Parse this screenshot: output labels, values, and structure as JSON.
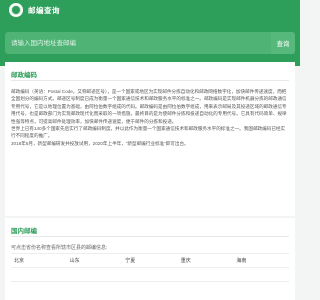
{
  "header": {
    "title": "邮编查询"
  },
  "search": {
    "placeholder": "请输入国内地址查邮编",
    "button_label": "查询"
  },
  "intro_card": {
    "title": "邮政编码",
    "paragraphs": [
      "邮政编码（英语：Postal Code，又称邮递区号），是一个国家或地区为实现邮件分拣自动化和邮政网络数字化，加快邮件传递速度，而把全国划分的编码方式。邮递区号制度已成为衡量一个国家通信技术和邮政服务水平的标准之一。邮政编码是实现邮件机器分拣的邮政通信专用代号，它是以地理位置为基础，由阿拉伯数字组成的代码。邮政编码是由阿拉伯数字组成，用来表示邮局及其投递区域的邮政通信专用代号，也是邮政部门为实现邮政现代化而采取的一项措施，最终目的是为使邮件分拣和投递自动化的专用代号。它具有代码简单、规律性强等特点，可提高邮件处理效率，加快邮件传递速度，便于邮件的分拣和投递。",
      "世界上已有140多个国家先后实行了邮政编码制度，并以此作为衡量一个国家通信技术和邮政服务水平的标准之一。我国邮政编码已经实行不同程度的推广。",
      "2018年5月，新型邮编研发并投放试用，2020年上半年，“新型邮编行业标准”即可出台。"
    ]
  },
  "province_card": {
    "title": "国内邮编",
    "note": "可点击省份名称查看所辖市区县的邮编信息:",
    "rows": [
      [
        "北京",
        "山东",
        "宁夏",
        "重庆",
        "海南"
      ],
      [
        "",
        "",
        "",
        "",
        ""
      ]
    ]
  },
  "colors": {
    "brand_green": "#2e9e5b",
    "title_green": "#2e9e5b",
    "background": "#f3f5f4"
  },
  "icons": {
    "logo": "postal-logo-icon"
  }
}
